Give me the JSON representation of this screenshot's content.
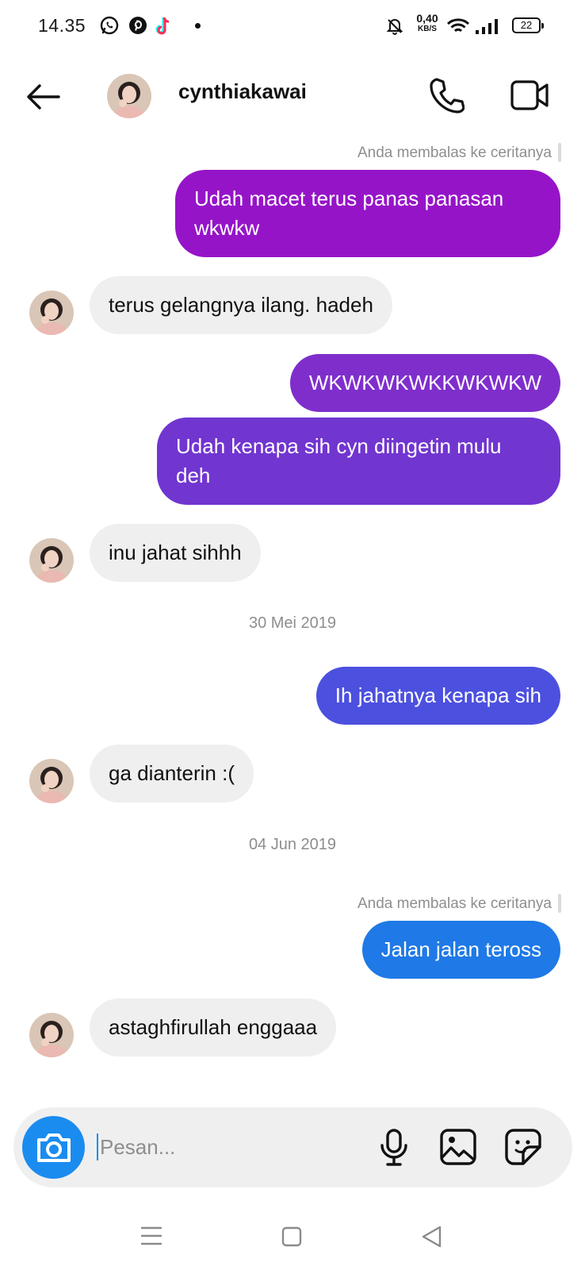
{
  "status_bar": {
    "time": "14.35",
    "net_speed_value": "0,40",
    "net_speed_unit": "KB/S",
    "battery": "22",
    "notification_icons": [
      "whatsapp-icon",
      "pinterest-icon",
      "tiktok-icon"
    ]
  },
  "header": {
    "username": "cynthiakawai",
    "icons": [
      "back-arrow-icon",
      "phone-icon",
      "video-call-icon"
    ]
  },
  "thread": {
    "items": [
      {
        "kind": "reply_note",
        "text": "Anda membalas ke ceritanya"
      },
      {
        "kind": "outgoing",
        "text": "Udah macet terus panas panasan wkwkw",
        "color": "#9614c8"
      },
      {
        "kind": "incoming",
        "text": "terus gelangnya ilang. hadeh"
      },
      {
        "kind": "outgoing",
        "text": "WKWKWKWKKWKWKW",
        "color": "#7f2ecc"
      },
      {
        "kind": "outgoing",
        "text": "Udah kenapa sih cyn diingetin mulu deh",
        "color": "#7135d0"
      },
      {
        "kind": "incoming",
        "text": "inu jahat sihhh"
      },
      {
        "kind": "date",
        "text": "30 Mei 2019"
      },
      {
        "kind": "outgoing",
        "text": "Ih jahatnya kenapa sih",
        "color": "#4c50df"
      },
      {
        "kind": "incoming",
        "text": "ga dianterin :("
      },
      {
        "kind": "date",
        "text": "04 Jun 2019"
      },
      {
        "kind": "reply_note",
        "text": "Anda membalas ke ceritanya"
      },
      {
        "kind": "outgoing",
        "text": "Jalan jalan teross",
        "color": "#1f79e6"
      },
      {
        "kind": "incoming",
        "text": "astaghfirullah enggaaa"
      }
    ]
  },
  "composer": {
    "placeholder": "Pesan...",
    "value": "",
    "camera_button_color": "#1a8cf0",
    "icons": [
      "camera-icon",
      "microphone-icon",
      "gallery-icon",
      "sticker-icon"
    ]
  },
  "nav_bar": {
    "icons": [
      "menu-icon",
      "home-icon",
      "back-triangle-icon"
    ]
  },
  "colors": {
    "incoming_bubble": "#efefef",
    "meta_text": "#8e8e8e"
  }
}
